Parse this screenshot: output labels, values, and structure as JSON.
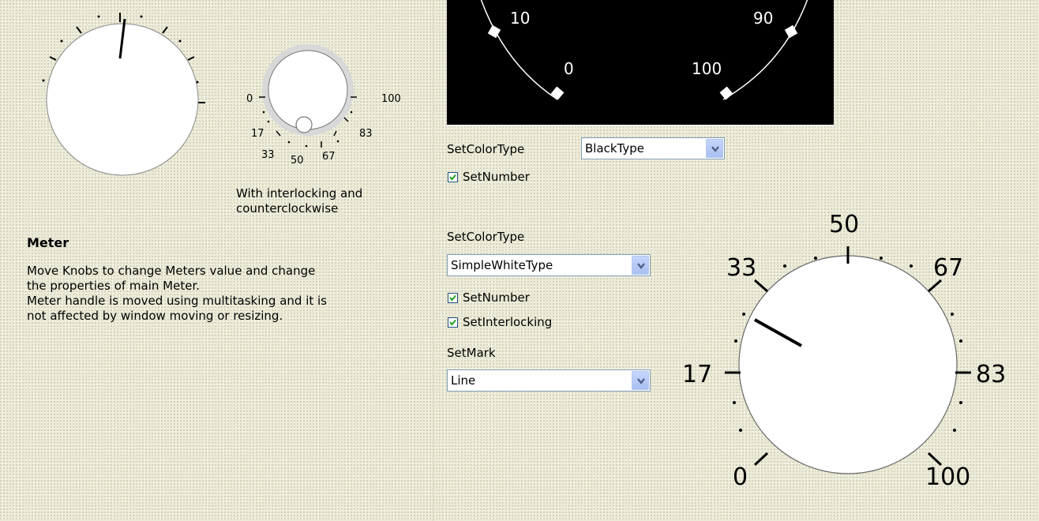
{
  "top_knob": {
    "caption_line1": "With interlocking and",
    "caption_line2": "counterclockwise"
  },
  "small_knob": {
    "scale_labels": [
      "0",
      "17",
      "33",
      "50",
      "67",
      "83",
      "100"
    ]
  },
  "meter_section": {
    "title": "Meter",
    "description_lines": [
      "Move Knobs to change Meters value and change",
      "the properties of main Meter.",
      "Meter handle is moved using multitasking and it is",
      "not affected by window moving or resizing."
    ]
  },
  "black_meter": {
    "scale_labels": [
      "10",
      "90",
      "0",
      "100"
    ]
  },
  "controls_1": {
    "color_type_label": "SetColorType",
    "color_type_value": "BlackType",
    "set_number_label": "SetNumber",
    "set_number_checked": true
  },
  "controls_2": {
    "color_type_label": "SetColorType",
    "color_type_value": "SimpleWhiteType",
    "set_number_label": "SetNumber",
    "set_number_checked": true,
    "set_interlocking_label": "SetInterlocking",
    "set_interlocking_checked": true,
    "mark_label": "SetMark",
    "mark_value": "Line"
  },
  "main_knob": {
    "scale_labels": [
      "0",
      "17",
      "33",
      "50",
      "67",
      "83",
      "100"
    ]
  },
  "colors": {
    "check_green": "#21a121",
    "input_border": "#7f9db9",
    "background": "#ecebd8"
  }
}
